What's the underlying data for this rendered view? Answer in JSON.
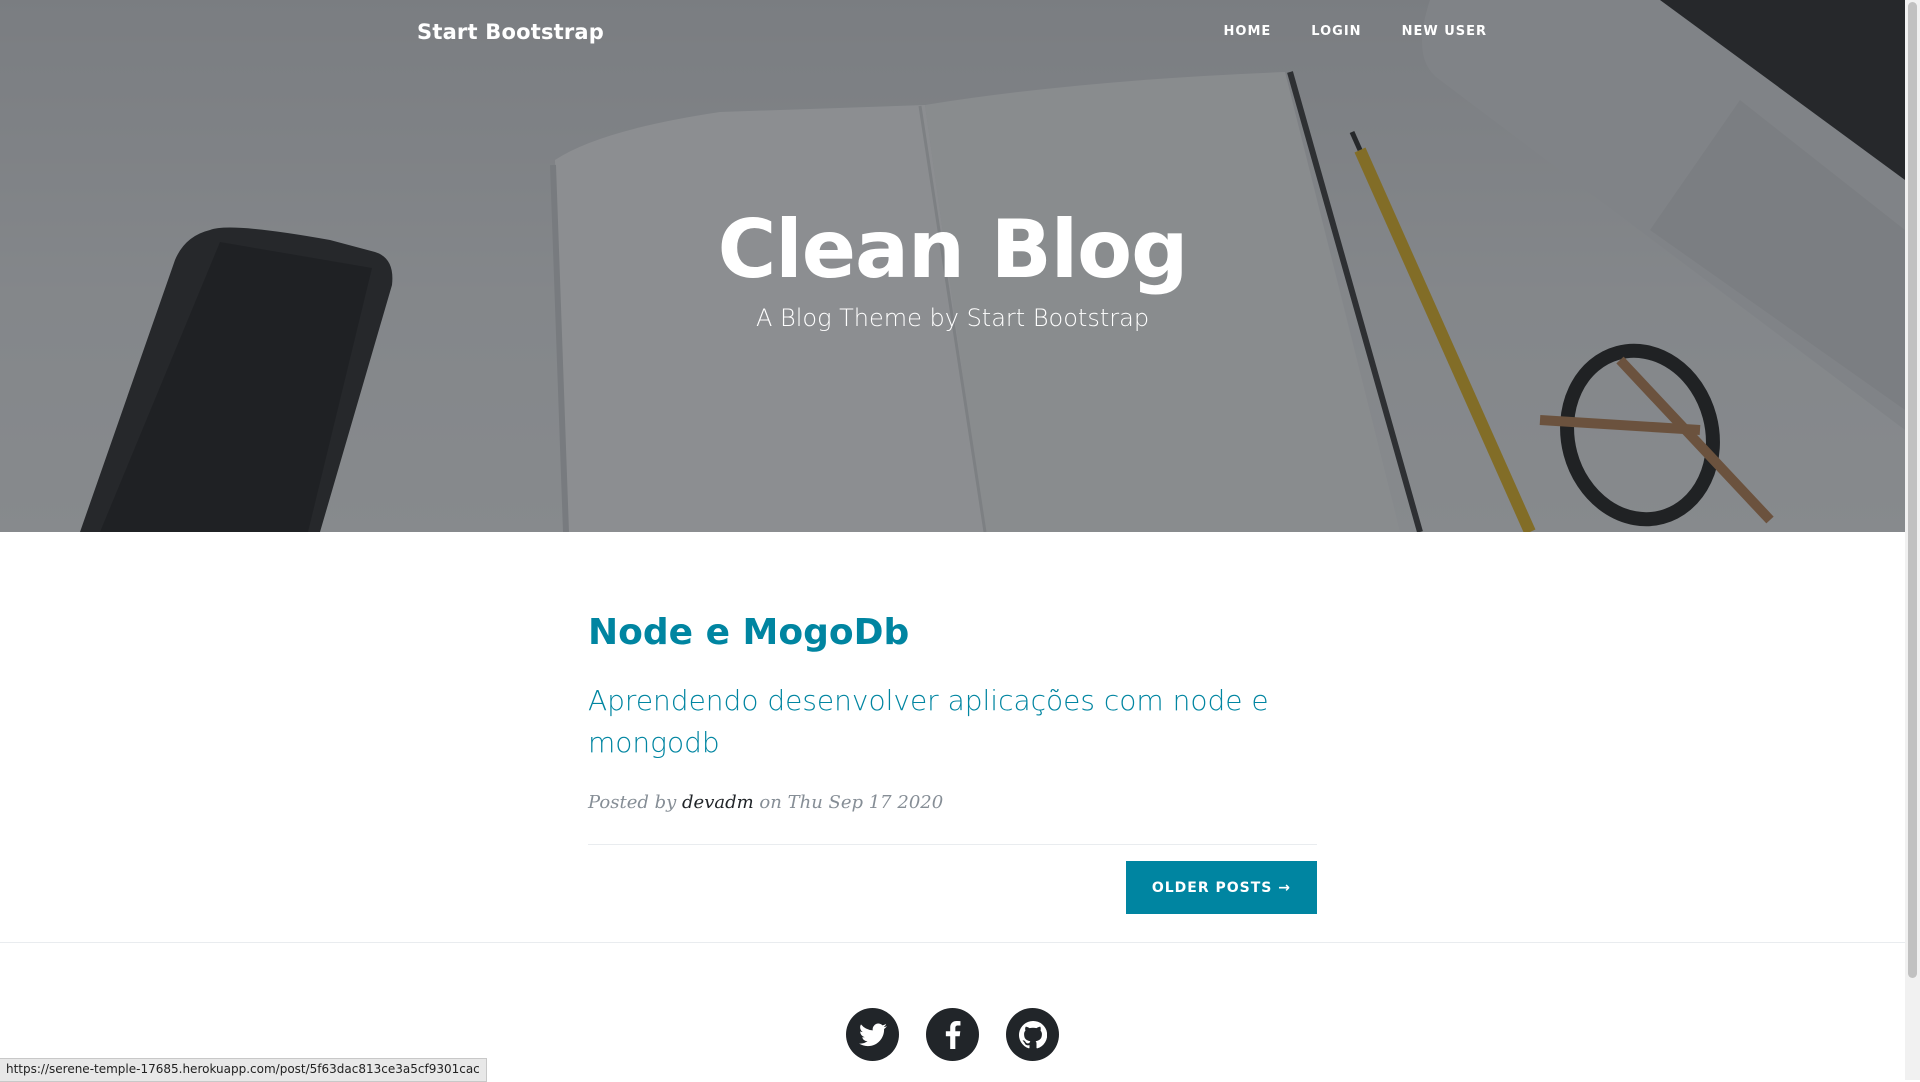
{
  "navbar": {
    "brand": "Start Bootstrap",
    "links": [
      "HOME",
      "LOGIN",
      "NEW USER"
    ]
  },
  "hero": {
    "title": "Clean Blog",
    "subtitle": "A Blog Theme by Start Bootstrap"
  },
  "post": {
    "title": "Node e MogoDb",
    "subtitle": "Aprendendo desenvolver aplicações com node e mongodb",
    "meta_prefix": "Posted by",
    "author": "devadm",
    "meta_on": "on",
    "date": "Thu Sep 17 2020"
  },
  "pager": {
    "older_label": "OLDER POSTS →"
  },
  "footer": {
    "social": [
      "twitter-icon",
      "facebook-icon",
      "github-icon"
    ]
  },
  "status": {
    "url": "https://serene-temple-17685.herokuapp.com/post/5f63dac813ce3a5cf9301cac"
  },
  "colors": {
    "accent": "#0085a1",
    "dark": "#212529",
    "meta": "#868e96"
  }
}
